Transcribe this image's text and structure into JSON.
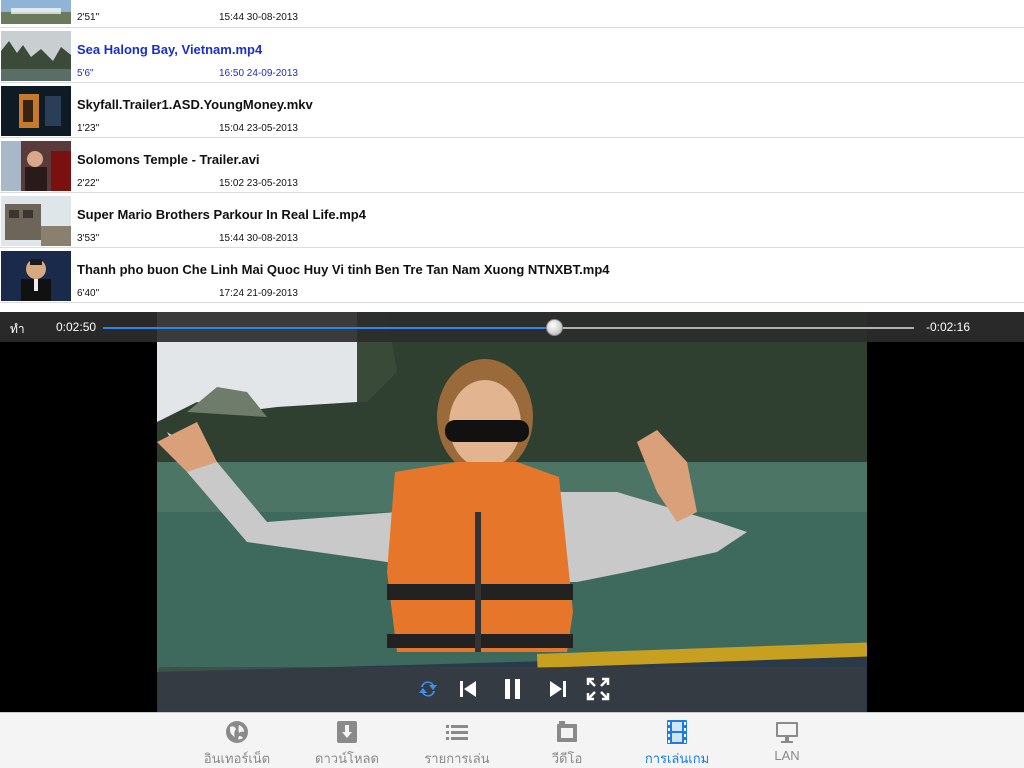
{
  "files": [
    {
      "name": "",
      "duration": "2'51\"",
      "date": "15:44 30-08-2013",
      "selected": false,
      "partial": true
    },
    {
      "name": "Sea Halong Bay, Vietnam.mp4",
      "duration": "5'6\"",
      "date": "16:50 24-09-2013",
      "selected": true
    },
    {
      "name": "Skyfall.Trailer1.ASD.YoungMoney.mkv",
      "duration": "1'23\"",
      "date": "15:04 23-05-2013",
      "selected": false
    },
    {
      "name": "Solomons Temple - Trailer.avi",
      "duration": "2'22\"",
      "date": "15:02 23-05-2013",
      "selected": false
    },
    {
      "name": "Super Mario Brothers Parkour In Real Life.mp4",
      "duration": "3'53\"",
      "date": "15:44 30-08-2013",
      "selected": false
    },
    {
      "name": "Thanh pho buon Che Linh Mai Quoc Huy Vi tinh Ben Tre Tan Nam Xuong NTNXBT.mp4",
      "duration": "6'40\"",
      "date": "17:24 21-09-2013",
      "selected": false
    }
  ],
  "player": {
    "done_label": "ทำ",
    "current_time": "0:02:50",
    "remaining_time": "-0:02:16",
    "progress": 0.556,
    "controls": [
      "repeat-icon",
      "previous-icon",
      "pause-icon",
      "next-icon",
      "fullscreen-icon"
    ]
  },
  "tabs": [
    {
      "label": "อินเทอร์เน็ต",
      "icon": "globe-icon",
      "active": false
    },
    {
      "label": "ดาวน์โหลด",
      "icon": "download-icon",
      "active": false
    },
    {
      "label": "รายการเล่น",
      "icon": "playlist-icon",
      "active": false
    },
    {
      "label": "วีดีโอ",
      "icon": "video-icon",
      "active": false
    },
    {
      "label": "การเล่นเกม",
      "icon": "film-icon",
      "active": true
    },
    {
      "label": "LAN",
      "icon": "monitor-icon",
      "active": false
    }
  ],
  "colors": {
    "accent": "#1c7ce6",
    "selected_text": "#1a2fc9",
    "seek_fill": "#2b86f0"
  }
}
